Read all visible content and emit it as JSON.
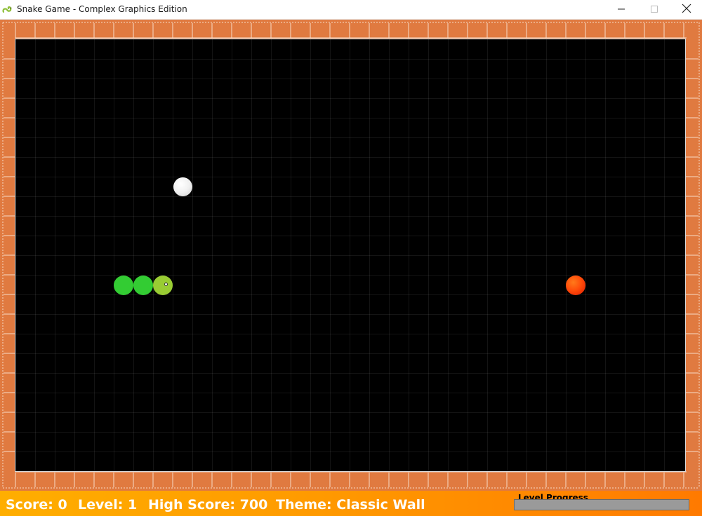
{
  "window": {
    "title": "Snake Game - Complex Graphics Edition",
    "app_icon": "snake-icon",
    "controls": [
      "minimize-icon",
      "maximize-icon",
      "close-icon"
    ]
  },
  "game": {
    "theme_colors": {
      "wall": "#e07a40",
      "board": "#000000",
      "snake_body": "#33cc33",
      "snake_head": "#99cc33",
      "food": "#ff4d0a",
      "bonus_food": "#f0f0f0"
    },
    "snake": {
      "direction": "right",
      "segment_count": 3
    },
    "items": [
      "food-apple",
      "bonus-food-white"
    ]
  },
  "status": {
    "score": "Score: 0",
    "level": "Level: 1",
    "high_score": "High Score: 700",
    "theme": "Theme: Classic Wall",
    "progress_label": "Level Progress",
    "progress_value": 0
  }
}
